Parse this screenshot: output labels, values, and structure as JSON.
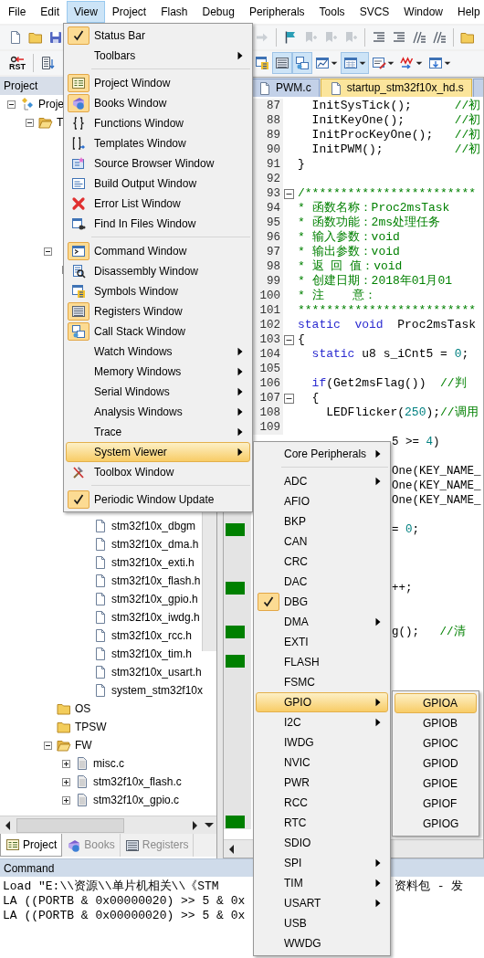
{
  "menubar": [
    {
      "label": "File",
      "selected": false
    },
    {
      "label": "Edit",
      "selected": false
    },
    {
      "label": "View",
      "selected": true
    },
    {
      "label": "Project",
      "selected": false
    },
    {
      "label": "Flash",
      "selected": false
    },
    {
      "label": "Debug",
      "selected": false
    },
    {
      "label": "Peripherals",
      "selected": false
    },
    {
      "label": "Tools",
      "selected": false
    },
    {
      "label": "SVCS",
      "selected": false
    },
    {
      "label": "Window",
      "selected": false
    },
    {
      "label": "Help",
      "selected": false
    }
  ],
  "toolbars": [
    {
      "left": [
        {
          "kind": "button",
          "pressed": false,
          "disabled": false,
          "dropdown": false
        },
        {
          "kind": "button",
          "pressed": false,
          "disabled": false,
          "dropdown": false
        },
        {
          "kind": "button",
          "pressed": false,
          "disabled": false,
          "dropdown": false
        }
      ],
      "right": [
        {
          "kind": "button",
          "pressed": false,
          "disabled": true,
          "dropdown": false
        },
        {
          "kind": "separator"
        },
        {
          "kind": "button",
          "pressed": false,
          "disabled": false,
          "dropdown": false
        },
        {
          "kind": "button",
          "pressed": false,
          "disabled": true,
          "dropdown": false
        },
        {
          "kind": "button",
          "pressed": false,
          "disabled": true,
          "dropdown": false
        },
        {
          "kind": "button",
          "pressed": false,
          "disabled": true,
          "dropdown": false
        },
        {
          "kind": "separator"
        },
        {
          "kind": "button",
          "pressed": false,
          "disabled": false,
          "dropdown": false
        },
        {
          "kind": "button",
          "pressed": false,
          "disabled": false,
          "dropdown": false
        },
        {
          "kind": "button",
          "pressed": false,
          "disabled": false,
          "dropdown": false
        },
        {
          "kind": "button",
          "pressed": false,
          "disabled": false,
          "dropdown": false
        },
        {
          "kind": "separator"
        },
        {
          "kind": "button",
          "pressed": false,
          "disabled": false,
          "dropdown": false
        }
      ]
    },
    {
      "left": [
        {
          "kind": "button",
          "label": "RST",
          "pressed": false,
          "disabled": false,
          "dropdown": false
        },
        {
          "kind": "separator"
        },
        {
          "kind": "button",
          "pressed": false,
          "disabled": false,
          "dropdown": false
        }
      ],
      "right": [
        {
          "kind": "button",
          "pressed": false,
          "disabled": false,
          "dropdown": false
        },
        {
          "kind": "button",
          "pressed": true,
          "disabled": false,
          "dropdown": false
        },
        {
          "kind": "button",
          "pressed": true,
          "disabled": false,
          "dropdown": false
        },
        {
          "kind": "button",
          "pressed": false,
          "disabled": false,
          "dropdown": true
        },
        {
          "kind": "button",
          "pressed": true,
          "disabled": false,
          "dropdown": true
        },
        {
          "kind": "button",
          "pressed": false,
          "disabled": false,
          "dropdown": true
        },
        {
          "kind": "button",
          "pressed": false,
          "disabled": false,
          "dropdown": true
        },
        {
          "kind": "button",
          "pressed": false,
          "disabled": false,
          "dropdown": true
        }
      ]
    }
  ],
  "project_panel": {
    "title": "Project",
    "nodes": [
      {
        "label": "Proje",
        "kind": "project",
        "expanded": true,
        "children": [
          {
            "label": "T",
            "kind": "target",
            "expanded": true,
            "children": [
              {
                "kind": "group",
                "expanded": true,
                "children": [
                  {
                    "kind": "group",
                    "expanded": true,
                    "children": [
                      {
                        "label": "stm32f10x_dbgm",
                        "kind": "header"
                      },
                      {
                        "label": "stm32f10x_dma.h",
                        "kind": "header"
                      },
                      {
                        "label": "stm32f10x_exti.h",
                        "kind": "header"
                      },
                      {
                        "label": "stm32f10x_flash.h",
                        "kind": "header"
                      },
                      {
                        "label": "stm32f10x_gpio.h",
                        "kind": "header"
                      },
                      {
                        "label": "stm32f10x_iwdg.h",
                        "kind": "header"
                      },
                      {
                        "label": "stm32f10x_rcc.h",
                        "kind": "header"
                      },
                      {
                        "label": "stm32f10x_tim.h",
                        "kind": "header"
                      },
                      {
                        "label": "stm32f10x_usart.h",
                        "kind": "header"
                      },
                      {
                        "label": "system_stm32f10x",
                        "kind": "header"
                      }
                    ]
                  }
                ]
              },
              {
                "label": "OS",
                "kind": "group"
              },
              {
                "label": "TPSW",
                "kind": "group"
              },
              {
                "label": "FW",
                "kind": "group",
                "expanded": true,
                "children": [
                  {
                    "label": "misc.c",
                    "kind": "source",
                    "expanded": false
                  },
                  {
                    "label": "stm32f10x_flash.c",
                    "kind": "source",
                    "expanded": false
                  },
                  {
                    "label": "stm32f10x_gpio.c",
                    "kind": "source",
                    "expanded": false
                  }
                ]
              }
            ]
          }
        ]
      }
    ],
    "tabs": [
      {
        "label": "Project",
        "selected": true
      },
      {
        "label": "Books",
        "selected": false
      },
      {
        "label": "Registers",
        "selected": false
      }
    ]
  },
  "editor": {
    "tabs": [
      {
        "label": "PWM.c",
        "selected": false
      },
      {
        "label": "startup_stm32f10x_hd.s",
        "selected": true
      },
      {
        "selected": false
      }
    ],
    "lines": [
      {
        "num": "87",
        "segments": [
          {
            "kind": "plain",
            "text": "  InitSysTick();      "
          },
          {
            "kind": "comment",
            "text": "//初"
          }
        ]
      },
      {
        "num": "88",
        "segments": [
          {
            "kind": "plain",
            "text": "  InitKeyOne();       "
          },
          {
            "kind": "comment",
            "text": "//初"
          }
        ]
      },
      {
        "num": "89",
        "segments": [
          {
            "kind": "plain",
            "text": "  InitProcKeyOne();   "
          },
          {
            "kind": "comment",
            "text": "//初"
          }
        ]
      },
      {
        "num": "90",
        "segments": [
          {
            "kind": "plain",
            "text": "  InitPWM();          "
          },
          {
            "kind": "comment",
            "text": "//初"
          }
        ]
      },
      {
        "num": "91",
        "segments": [
          {
            "kind": "plain",
            "text": "}"
          }
        ]
      },
      {
        "num": "92"
      },
      {
        "num": "93",
        "foldable": true,
        "segments": [
          {
            "kind": "comment",
            "text": "/************************"
          }
        ]
      },
      {
        "num": "94",
        "segments": [
          {
            "kind": "comment",
            "text": "* 函数名称：Proc2msTask"
          }
        ]
      },
      {
        "num": "95",
        "segments": [
          {
            "kind": "comment",
            "text": "* 函数功能：2ms处理任务"
          }
        ]
      },
      {
        "num": "96",
        "segments": [
          {
            "kind": "comment",
            "text": "* 输入参数：void"
          }
        ]
      },
      {
        "num": "97",
        "segments": [
          {
            "kind": "comment",
            "text": "* 输出参数：void"
          }
        ]
      },
      {
        "num": "98",
        "segments": [
          {
            "kind": "comment",
            "text": "* 返 回 值：void"
          }
        ]
      },
      {
        "num": "99",
        "segments": [
          {
            "kind": "comment",
            "text": "* 创建日期：2018年01月01"
          }
        ]
      },
      {
        "num": "100",
        "segments": [
          {
            "kind": "comment",
            "text": "* 注    意："
          }
        ]
      },
      {
        "num": "101",
        "segments": [
          {
            "kind": "comment",
            "text": "*************************"
          }
        ]
      },
      {
        "num": "102",
        "segments": [
          {
            "kind": "keyword",
            "text": "static"
          },
          {
            "kind": "keyword",
            "text": "  void"
          },
          {
            "kind": "plain",
            "text": "  Proc2msTask"
          }
        ]
      },
      {
        "num": "103",
        "foldable": true,
        "segments": [
          {
            "kind": "plain",
            "text": "{"
          }
        ]
      },
      {
        "num": "104",
        "segments": [
          {
            "kind": "keyword",
            "text": "  static"
          },
          {
            "kind": "plain",
            "text": " u8 s_iCnt5 = "
          },
          {
            "kind": "number",
            "text": "0"
          },
          {
            "kind": "plain",
            "text": ";"
          }
        ]
      },
      {
        "num": "105"
      },
      {
        "num": "106",
        "segments": [
          {
            "kind": "keyword",
            "text": "  if"
          },
          {
            "kind": "plain",
            "text": "(Get2msFlag())  "
          },
          {
            "kind": "comment",
            "text": "//判"
          }
        ]
      },
      {
        "num": "107",
        "foldable": true,
        "segments": [
          {
            "kind": "plain",
            "text": "  {"
          }
        ]
      },
      {
        "num": "108",
        "segments": [
          {
            "kind": "plain",
            "text": "    LEDFlicker("
          },
          {
            "kind": "number",
            "text": "250"
          },
          {
            "kind": "plain",
            "text": ");"
          },
          {
            "kind": "comment",
            "text": "//调用"
          }
        ]
      },
      {
        "num": "109"
      },
      {
        "segments": [
          {
            "kind": "plain",
            "text": "5 >= "
          },
          {
            "kind": "number",
            "text": "4"
          },
          {
            "kind": "plain",
            "text": ")"
          }
        ]
      },
      {
        "segments": [
          {
            "kind": "plain",
            "text": "One(KEY_NAME_"
          }
        ]
      },
      {
        "segments": [
          {
            "kind": "plain",
            "text": "One(KEY_NAME_"
          }
        ]
      },
      {
        "segments": [
          {
            "kind": "plain",
            "text": "One(KEY_NAME_"
          }
        ]
      },
      {
        "covered": false
      },
      {
        "covered": true,
        "segments": [
          {
            "kind": "plain",
            "text": "= "
          },
          {
            "kind": "number",
            "text": "0"
          },
          {
            "kind": "plain",
            "text": ";"
          }
        ]
      },
      {
        "covered": false
      },
      {
        "covered": false
      },
      {
        "covered": false
      },
      {
        "covered": true,
        "segments": [
          {
            "kind": "plain",
            "text": "++;"
          }
        ]
      },
      {
        "covered": false
      },
      {
        "covered": false
      },
      {
        "covered": true,
        "segments": [
          {
            "kind": "plain",
            "text": "g();   "
          },
          {
            "kind": "comment",
            "text": "//清"
          }
        ]
      },
      {
        "covered": false
      },
      {
        "covered": true
      },
      {
        "covered": false
      },
      {
        "covered": false
      },
      {
        "covered": false
      },
      {
        "covered": false
      },
      {
        "covered": false
      },
      {
        "covered": false
      },
      {
        "covered": false
      },
      {
        "covered": false
      },
      {
        "covered": false
      },
      {
        "covered": false
      },
      {
        "covered": true
      }
    ]
  },
  "command": {
    "title": "Command",
    "lines": [
      {
        "text": "Load \"E:\\\\资源\\\\单片机相关\\\\《STM",
        "tail": "资料包 - 发"
      },
      {
        "text": "LA ((PORTB & 0x00000020) >> 5 & 0x"
      },
      {
        "text": "LA ((PORTB & 0x00000020) >> 5 & 0x"
      }
    ]
  },
  "view_menu": [
    {
      "kind": "item",
      "label": "Status Bar",
      "checked": true,
      "submenu": false,
      "selected": false
    },
    {
      "kind": "item",
      "label": "Toolbars",
      "checked": false,
      "submenu": true,
      "selected": false
    },
    {
      "kind": "separator"
    },
    {
      "kind": "item",
      "label": "Project Window",
      "checked": true,
      "submenu": false,
      "selected": false
    },
    {
      "kind": "item",
      "label": "Books Window",
      "checked": true,
      "submenu": false,
      "selected": false
    },
    {
      "kind": "item",
      "label": "Functions Window",
      "checked": false,
      "submenu": false,
      "selected": false
    },
    {
      "kind": "item",
      "label": "Templates Window",
      "checked": false,
      "submenu": false,
      "selected": false
    },
    {
      "kind": "item",
      "label": "Source Browser Window",
      "checked": false,
      "submenu": false,
      "selected": false
    },
    {
      "kind": "item",
      "label": "Build Output Window",
      "checked": false,
      "submenu": false,
      "selected": false
    },
    {
      "kind": "item",
      "label": "Error List Window",
      "checked": false,
      "submenu": false,
      "selected": false
    },
    {
      "kind": "item",
      "label": "Find In Files Window",
      "checked": false,
      "submenu": false,
      "selected": false
    },
    {
      "kind": "separator"
    },
    {
      "kind": "item",
      "label": "Command Window",
      "checked": true,
      "submenu": false,
      "selected": false
    },
    {
      "kind": "item",
      "label": "Disassembly Window",
      "checked": false,
      "submenu": false,
      "selected": false
    },
    {
      "kind": "item",
      "label": "Symbols Window",
      "checked": false,
      "submenu": false,
      "selected": false
    },
    {
      "kind": "item",
      "label": "Registers Window",
      "checked": true,
      "submenu": false,
      "selected": false
    },
    {
      "kind": "item",
      "label": "Call Stack Window",
      "checked": true,
      "submenu": false,
      "selected": false
    },
    {
      "kind": "item",
      "label": "Watch Windows",
      "checked": false,
      "submenu": true,
      "selected": false
    },
    {
      "kind": "item",
      "label": "Memory Windows",
      "checked": false,
      "submenu": true,
      "selected": false
    },
    {
      "kind": "item",
      "label": "Serial Windows",
      "checked": false,
      "submenu": true,
      "selected": false
    },
    {
      "kind": "item",
      "label": "Analysis Windows",
      "checked": false,
      "submenu": true,
      "selected": false
    },
    {
      "kind": "item",
      "label": "Trace",
      "checked": false,
      "submenu": true,
      "selected": false
    },
    {
      "kind": "item",
      "label": "System Viewer",
      "checked": false,
      "submenu": true,
      "selected": true
    },
    {
      "kind": "item",
      "label": "Toolbox Window",
      "checked": false,
      "submenu": false,
      "selected": false
    },
    {
      "kind": "separator"
    },
    {
      "kind": "item",
      "label": "Periodic Window Update",
      "checked": true,
      "submenu": false,
      "selected": false
    }
  ],
  "system_viewer_menu": [
    {
      "kind": "item",
      "label": "Core Peripherals",
      "checked": false,
      "submenu": true,
      "selected": false
    },
    {
      "kind": "separator"
    },
    {
      "kind": "item",
      "label": "ADC",
      "checked": false,
      "submenu": true,
      "selected": false
    },
    {
      "kind": "item",
      "label": "AFIO",
      "checked": false,
      "submenu": false,
      "selected": false
    },
    {
      "kind": "item",
      "label": "BKP",
      "checked": false,
      "submenu": false,
      "selected": false
    },
    {
      "kind": "item",
      "label": "CAN",
      "checked": false,
      "submenu": false,
      "selected": false
    },
    {
      "kind": "item",
      "label": "CRC",
      "checked": false,
      "submenu": false,
      "selected": false
    },
    {
      "kind": "item",
      "label": "DAC",
      "checked": false,
      "submenu": false,
      "selected": false
    },
    {
      "kind": "item",
      "label": "DBG",
      "checked": true,
      "submenu": false,
      "selected": false
    },
    {
      "kind": "item",
      "label": "DMA",
      "checked": false,
      "submenu": true,
      "selected": false
    },
    {
      "kind": "item",
      "label": "EXTI",
      "checked": false,
      "submenu": false,
      "selected": false
    },
    {
      "kind": "item",
      "label": "FLASH",
      "checked": false,
      "submenu": false,
      "selected": false
    },
    {
      "kind": "item",
      "label": "FSMC",
      "checked": false,
      "submenu": false,
      "selected": false
    },
    {
      "kind": "item",
      "label": "GPIO",
      "checked": false,
      "submenu": true,
      "selected": true
    },
    {
      "kind": "item",
      "label": "I2C",
      "checked": false,
      "submenu": true,
      "selected": false
    },
    {
      "kind": "item",
      "label": "IWDG",
      "checked": false,
      "submenu": false,
      "selected": false
    },
    {
      "kind": "item",
      "label": "NVIC",
      "checked": false,
      "submenu": false,
      "selected": false
    },
    {
      "kind": "item",
      "label": "PWR",
      "checked": false,
      "submenu": false,
      "selected": false
    },
    {
      "kind": "item",
      "label": "RCC",
      "checked": false,
      "submenu": false,
      "selected": false
    },
    {
      "kind": "item",
      "label": "RTC",
      "checked": false,
      "submenu": false,
      "selected": false
    },
    {
      "kind": "item",
      "label": "SDIO",
      "checked": false,
      "submenu": false,
      "selected": false
    },
    {
      "kind": "item",
      "label": "SPI",
      "checked": false,
      "submenu": true,
      "selected": false
    },
    {
      "kind": "item",
      "label": "TIM",
      "checked": false,
      "submenu": true,
      "selected": false
    },
    {
      "kind": "item",
      "label": "USART",
      "checked": false,
      "submenu": true,
      "selected": false
    },
    {
      "kind": "item",
      "label": "USB",
      "checked": false,
      "submenu": false,
      "selected": false
    },
    {
      "kind": "item",
      "label": "WWDG",
      "checked": false,
      "submenu": false,
      "selected": false
    }
  ],
  "gpio_menu": [
    {
      "kind": "item",
      "label": "GPIOA",
      "checked": false,
      "submenu": false,
      "selected": true
    },
    {
      "kind": "item",
      "label": "GPIOB",
      "checked": false,
      "submenu": false,
      "selected": false
    },
    {
      "kind": "item",
      "label": "GPIOC",
      "checked": false,
      "submenu": false,
      "selected": false
    },
    {
      "kind": "item",
      "label": "GPIOD",
      "checked": false,
      "submenu": false,
      "selected": false
    },
    {
      "kind": "item",
      "label": "GPIOE",
      "checked": false,
      "submenu": false,
      "selected": false
    },
    {
      "kind": "item",
      "label": "GPIOF",
      "checked": false,
      "submenu": false,
      "selected": false
    },
    {
      "kind": "item",
      "label": "GPIOG",
      "checked": false,
      "submenu": false,
      "selected": false
    }
  ]
}
